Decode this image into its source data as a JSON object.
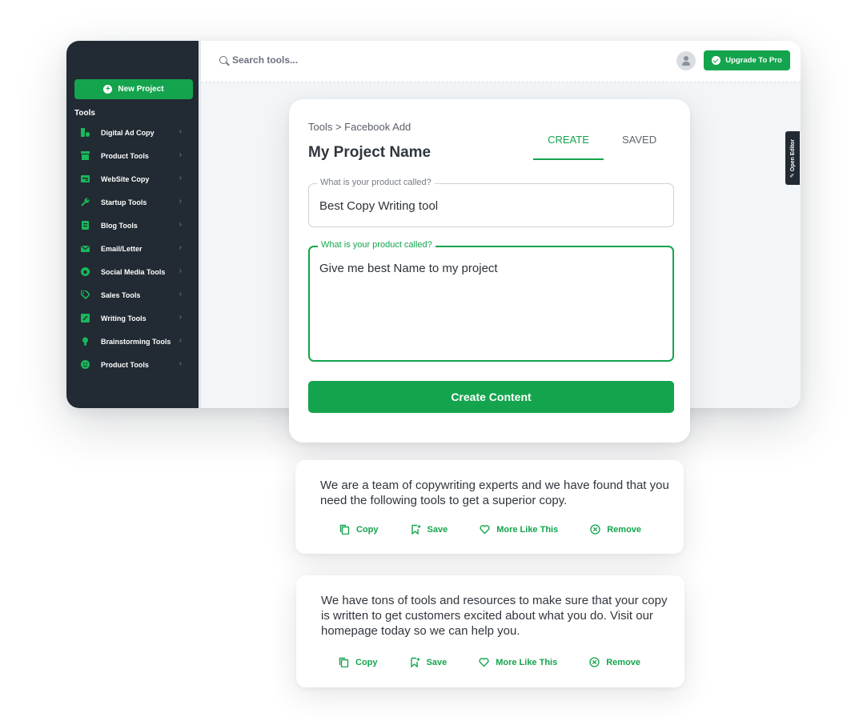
{
  "sidebar": {
    "new_project_label": "New Project",
    "tools_heading": "Tools",
    "items": [
      {
        "label": "Digital Ad Copy",
        "icon": "chart-icon"
      },
      {
        "label": "Product Tools",
        "icon": "box-icon"
      },
      {
        "label": "WebSite Copy",
        "icon": "browser-icon"
      },
      {
        "label": "Startup Tools",
        "icon": "wrench-icon"
      },
      {
        "label": "Blog Tools",
        "icon": "document-icon"
      },
      {
        "label": "Email/Letter",
        "icon": "mail-icon"
      },
      {
        "label": "Social Media Tools",
        "icon": "globe-icon"
      },
      {
        "label": "Sales Tools",
        "icon": "tag-icon"
      },
      {
        "label": "Writing Tools",
        "icon": "pencil-square-icon"
      },
      {
        "label": "Brainstorming Tools",
        "icon": "lightbulb-icon"
      },
      {
        "label": "Product Tools",
        "icon": "smiley-icon"
      }
    ]
  },
  "topbar": {
    "search_placeholder": "Search tools...",
    "upgrade_label": "Upgrade To Pro"
  },
  "open_editor_label": "Open Editor",
  "form": {
    "breadcrumb": "Tools > Facebook Add",
    "title": "My Project Name",
    "tabs": [
      {
        "label": "CREATE",
        "active": true
      },
      {
        "label": "SAVED",
        "active": false
      }
    ],
    "field1": {
      "label": "What is your product called?",
      "value": "Best Copy Writing tool"
    },
    "field2": {
      "label": "What is your product called?",
      "value": "Give me best Name to my project"
    },
    "submit_label": "Create Content"
  },
  "results": [
    {
      "text": "We are a team of copywriting experts and we have found that you need the following tools to get a superior copy.",
      "actions": [
        "Copy",
        "Save",
        "More Like This",
        "Remove"
      ]
    },
    {
      "text": "We have tons of tools and resources to make sure that your copy is written to get customers excited about what you do. Visit our homepage today so we can help you.",
      "actions": [
        "Copy",
        "Save",
        "More Like This",
        "Remove"
      ]
    }
  ],
  "colors": {
    "accent": "#14a44d",
    "sidebar_bg": "#222a33"
  }
}
